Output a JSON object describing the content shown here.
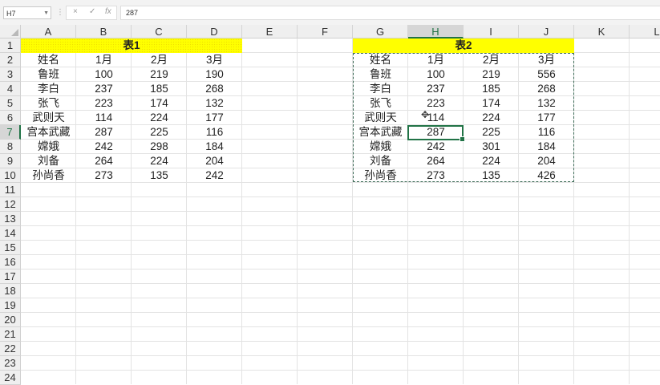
{
  "formula_bar": {
    "name_box": "H7",
    "cancel_icon": "×",
    "enter_icon": "✓",
    "fx_label": "fx",
    "value": "287"
  },
  "columns": [
    "A",
    "B",
    "C",
    "D",
    "E",
    "F",
    "G",
    "H",
    "I",
    "J",
    "K",
    "L"
  ],
  "selected_column": "H",
  "rows": [
    "1",
    "2",
    "3",
    "4",
    "5",
    "6",
    "7",
    "8",
    "9",
    "10",
    "11",
    "12",
    "13",
    "14",
    "15",
    "16",
    "17",
    "18",
    "19",
    "20",
    "21",
    "22",
    "23",
    "24"
  ],
  "selected_row": "7",
  "table1": {
    "title": "表1",
    "header": [
      "姓名",
      "1月",
      "2月",
      "3月"
    ],
    "rows": [
      [
        "鲁班",
        "100",
        "219",
        "190"
      ],
      [
        "李白",
        "237",
        "185",
        "268"
      ],
      [
        "张飞",
        "223",
        "174",
        "132"
      ],
      [
        "武则天",
        "114",
        "224",
        "177"
      ],
      [
        "宫本武藏",
        "287",
        "225",
        "116"
      ],
      [
        "嫦娥",
        "242",
        "298",
        "184"
      ],
      [
        "刘备",
        "264",
        "224",
        "204"
      ],
      [
        "孙尚香",
        "273",
        "135",
        "242"
      ]
    ]
  },
  "table2": {
    "title": "表2",
    "header": [
      "姓名",
      "1月",
      "2月",
      "3月"
    ],
    "rows": [
      [
        "鲁班",
        "100",
        "219",
        "556"
      ],
      [
        "李白",
        "237",
        "185",
        "268"
      ],
      [
        "张飞",
        "223",
        "174",
        "132"
      ],
      [
        "武则天",
        "114",
        "224",
        "177"
      ],
      [
        "宫本武藏",
        "287",
        "225",
        "116"
      ],
      [
        "嫦娥",
        "242",
        "301",
        "184"
      ],
      [
        "刘备",
        "264",
        "224",
        "204"
      ],
      [
        "孙尚香",
        "273",
        "135",
        "426"
      ]
    ]
  },
  "colors": {
    "title_fill": "#ffff00",
    "accent": "#217346"
  }
}
